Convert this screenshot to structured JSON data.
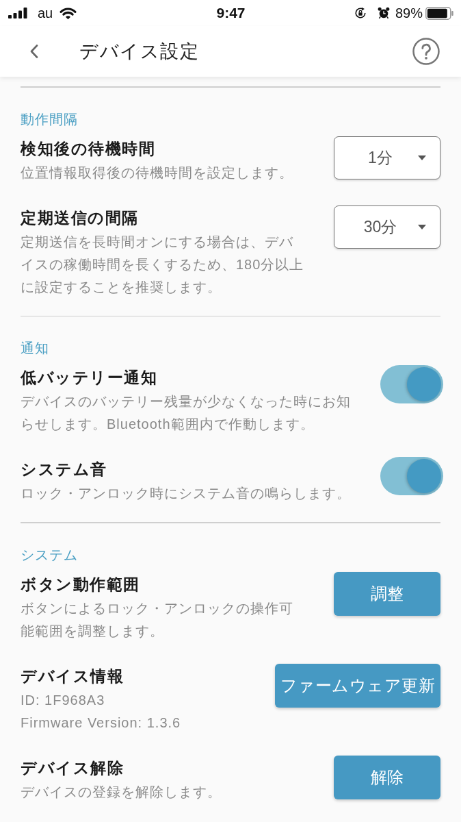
{
  "status_bar": {
    "carrier": "au",
    "time": "9:47",
    "battery": "89%"
  },
  "header": {
    "title": "デバイス設定"
  },
  "sections": [
    {
      "title": "動作間隔",
      "items": [
        {
          "kind": "select",
          "title": "検知後の待機時間",
          "description": "位置情報取得後の待機時間を設定します。",
          "value": "1分"
        },
        {
          "kind": "select",
          "title": "定期送信の間隔",
          "description": "定期送信を長時間オンにする場合は、デバイスの稼働時間を長くするため、180分以上に設定することを推奨します。",
          "value": "30分"
        }
      ]
    },
    {
      "title": "通知",
      "items": [
        {
          "kind": "toggle",
          "title": "低バッテリー通知",
          "description": "デバイスのバッテリー残量が少なくなった時にお知らせします。Bluetooth範囲内で作動します。",
          "on": true
        },
        {
          "kind": "toggle",
          "title": "システム音",
          "description": "ロック・アンロック時にシステム音の鳴らします。",
          "on": true
        }
      ]
    },
    {
      "title": "システム",
      "items": [
        {
          "kind": "button",
          "title": "ボタン動作範囲",
          "description": "ボタンによるロック・アンロックの操作可能範囲を調整します。",
          "button": "調整"
        },
        {
          "kind": "button",
          "title": "デバイス情報",
          "lines": [
            "ID: 1F968A3",
            "Firmware Version: 1.3.6"
          ],
          "button": "ファームウェア更新"
        },
        {
          "kind": "button",
          "title": "デバイス解除",
          "description": "デバイスの登録を解除します。",
          "button": "解除"
        }
      ]
    }
  ]
}
